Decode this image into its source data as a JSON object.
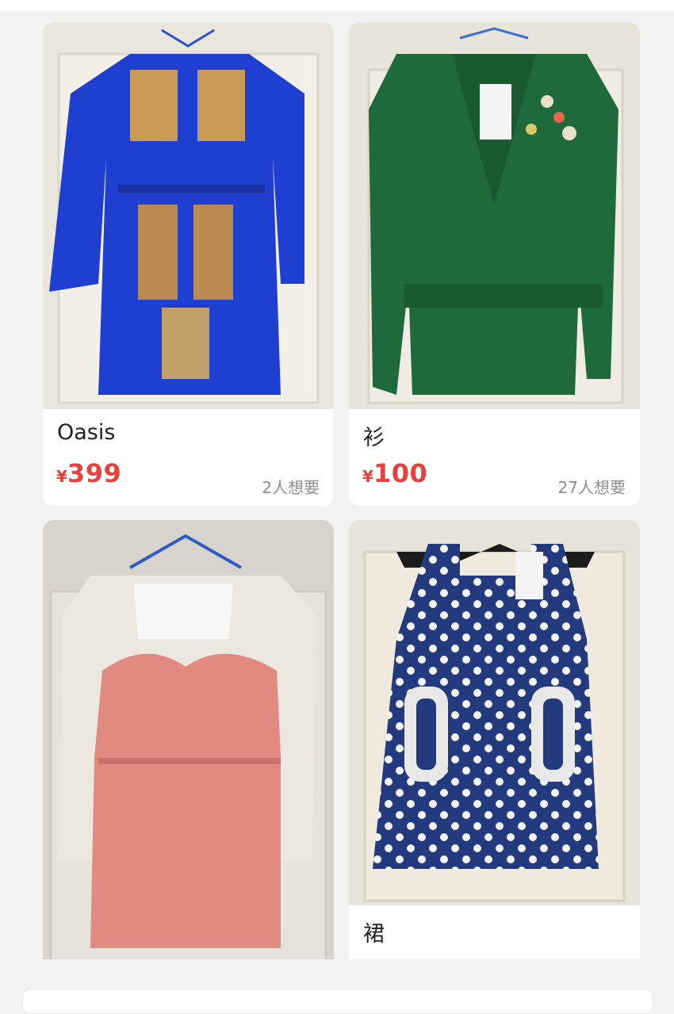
{
  "feed": {
    "items": [
      {
        "title": "Oasis",
        "currency": "¥",
        "price": "399",
        "wants": "2人想要",
        "image": "blue-baroque-print-dress-photo"
      },
      {
        "title": "衫",
        "currency": "¥",
        "price": "100",
        "wants": "27人想要",
        "image": "green-cardigan-photo"
      },
      {
        "title": "",
        "image": "pink-lace-dress-photo"
      },
      {
        "title": "裙",
        "image": "navy-polka-dot-dress-photo"
      }
    ]
  },
  "colors": {
    "price": "#e8403a",
    "want_text": "#8e8e8e",
    "background": "#f2f2f2",
    "card": "#ffffff"
  }
}
